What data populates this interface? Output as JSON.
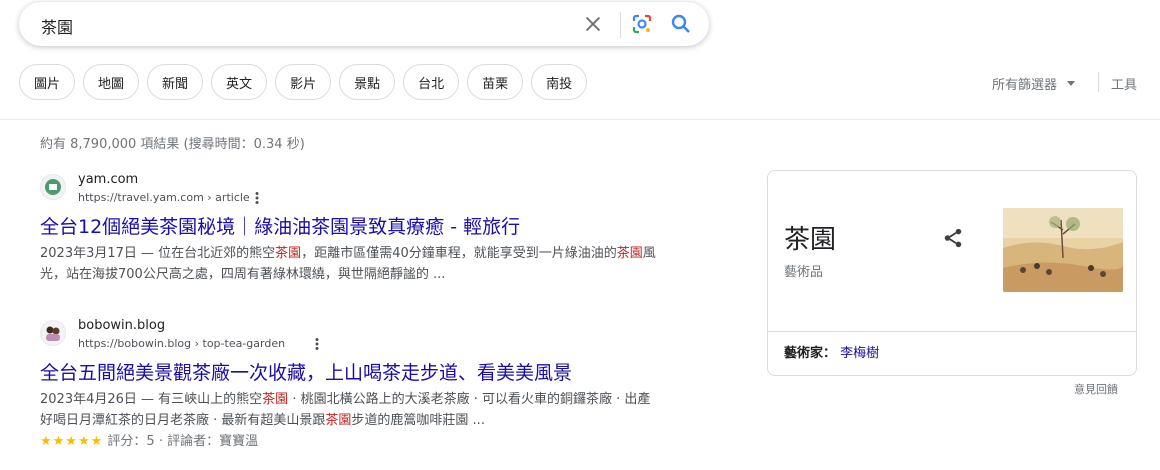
{
  "search": {
    "query": "茶園"
  },
  "chips": [
    "圖片",
    "地圖",
    "新聞",
    "英文",
    "影片",
    "景點",
    "台北",
    "苗栗",
    "南投"
  ],
  "filters": {
    "all_filters": "所有篩選器",
    "tools": "工具"
  },
  "stats": "約有 8,790,000 項結果 (搜尋時間：0.34 秒)",
  "results": [
    {
      "site": "yam.com",
      "url": "https://travel.yam.com › article",
      "title": "全台12個絕美茶園秘境｜綠油油茶園景致真療癒 - 輕旅行",
      "snippet_parts": [
        {
          "t": "2023年3月17日 — 位在台北近郊的熊空",
          "hl": false
        },
        {
          "t": "茶園",
          "hl": true
        },
        {
          "t": "，距離市區僅需40分鐘車程，就能享受到一片綠油油的",
          "hl": false
        },
        {
          "t": "茶園",
          "hl": true
        },
        {
          "t": "風光，站在海拔700公尺高之處，四周有著綠林環繞，與世隔絕靜謐的 ...",
          "hl": false
        }
      ]
    },
    {
      "site": "bobowin.blog",
      "url": "https://bobowin.blog › top-tea-garden",
      "title": "全台五間絕美景觀茶廠一次收藏，上山喝茶走步道、看美美風景",
      "snippet_parts": [
        {
          "t": "2023年4月26日 — 有三峽山上的熊空",
          "hl": false
        },
        {
          "t": "茶園",
          "hl": true
        },
        {
          "t": " · 桃園北橫公路上的大溪老茶廠 · 可以看火車的銅鑼茶廠 · 出產好喝日月潭紅茶的日月老茶廠 · 最新有超美山景跟",
          "hl": false
        },
        {
          "t": "茶園",
          "hl": true
        },
        {
          "t": "步道的鹿篙咖啡莊園 ...",
          "hl": false
        }
      ],
      "stars": "★★★★★",
      "rating": "評分：5 · 評論者：寶寶溫"
    }
  ],
  "knowledge_panel": {
    "title": "茶園",
    "subtitle": "藝術品",
    "attr_key": "藝術家：",
    "attr_value": "李梅樹",
    "feedback": "意見回饋"
  },
  "colors": {
    "link": "#1a0dab",
    "highlight": "#c5221f",
    "star": "#fbbc04"
  }
}
